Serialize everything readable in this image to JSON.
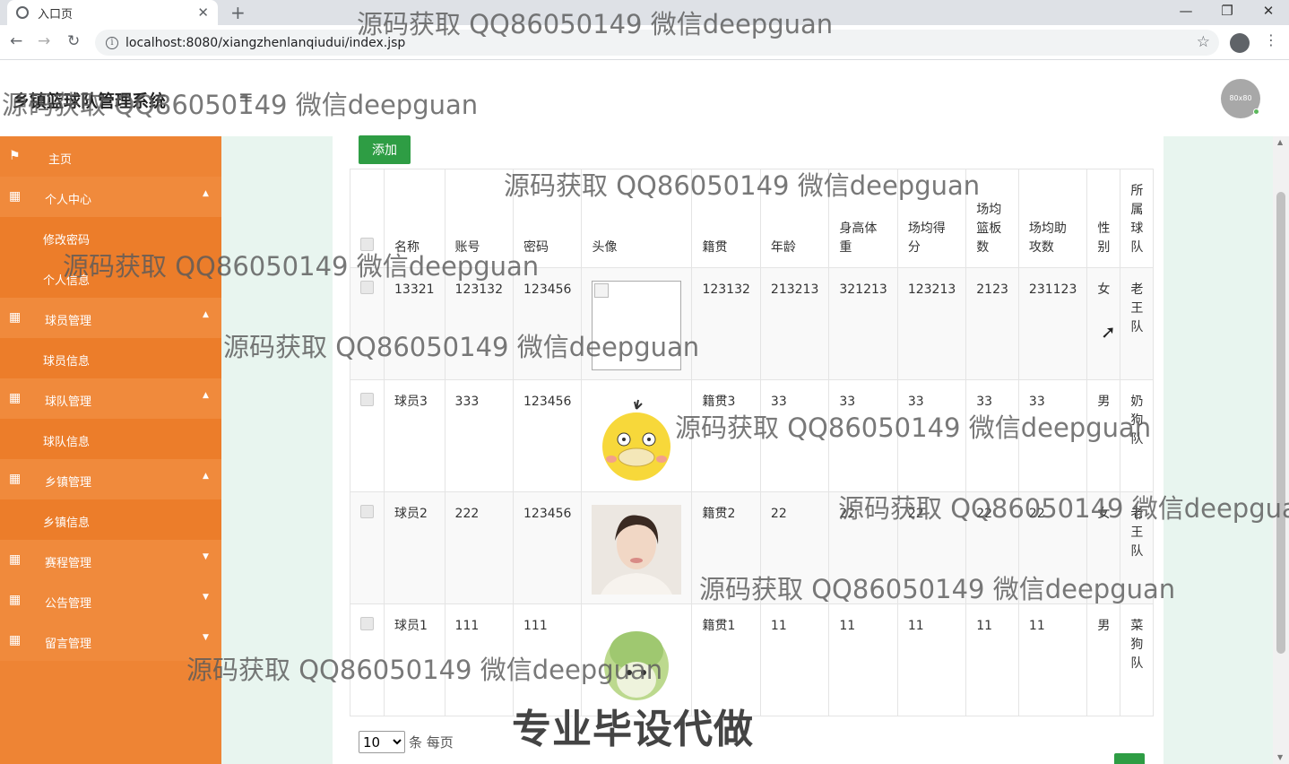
{
  "browser": {
    "tab_title": "入口页",
    "url": "localhost:8080/xiangzhenlanqiudui/index.jsp"
  },
  "app": {
    "title": "乡镇篮球队管理系统",
    "avatar_text": "80x80"
  },
  "sidebar": {
    "home": "主页",
    "groups": [
      {
        "label": "个人中心",
        "sub": [
          "修改密码",
          "个人信息"
        ]
      },
      {
        "label": "球员管理",
        "sub": [
          "球员信息"
        ]
      },
      {
        "label": "球队管理",
        "sub": [
          "球队信息"
        ]
      },
      {
        "label": "乡镇管理",
        "sub": [
          "乡镇信息"
        ]
      },
      {
        "label": "赛程管理",
        "sub": []
      },
      {
        "label": "公告管理",
        "sub": []
      },
      {
        "label": "留言管理",
        "sub": []
      }
    ]
  },
  "toolbar": {
    "add_label": "添加"
  },
  "table": {
    "headers": [
      "名称",
      "账号",
      "密码",
      "头像",
      "籍贯",
      "年龄",
      "身高体重",
      "场均得分",
      "场均篮板数",
      "场均助攻数",
      "性别",
      "所属球队"
    ],
    "rows": [
      {
        "name": "13321",
        "account": "123132",
        "password": "123456",
        "avatar": "broken",
        "native": "123132",
        "age": "213213",
        "height_weight": "321213",
        "points": "123213",
        "rebounds": "2123",
        "assists": "231123",
        "gender": "女",
        "team": "老王队"
      },
      {
        "name": "球员3",
        "account": "333",
        "password": "123456",
        "avatar": "duck",
        "native": "籍贯3",
        "age": "33",
        "height_weight": "33",
        "points": "33",
        "rebounds": "33",
        "assists": "33",
        "gender": "男",
        "team": "奶狗队"
      },
      {
        "name": "球员2",
        "account": "222",
        "password": "123456",
        "avatar": "woman",
        "native": "籍贯2",
        "age": "22",
        "height_weight": "22",
        "points": "22",
        "rebounds": "22",
        "assists": "22",
        "gender": "女",
        "team": "老王队"
      },
      {
        "name": "球员1",
        "account": "111",
        "password": "111",
        "avatar": "cabbage",
        "native": "籍贯1",
        "age": "11",
        "height_weight": "11",
        "points": "11",
        "rebounds": "11",
        "assists": "11",
        "gender": "男",
        "team": "菜狗队"
      }
    ]
  },
  "pagination": {
    "page_size": "10",
    "suffix": "条 每页"
  },
  "watermarks": {
    "text": "源码获取 QQ86050149 微信deepguan",
    "banner": "专业毕设代做"
  }
}
